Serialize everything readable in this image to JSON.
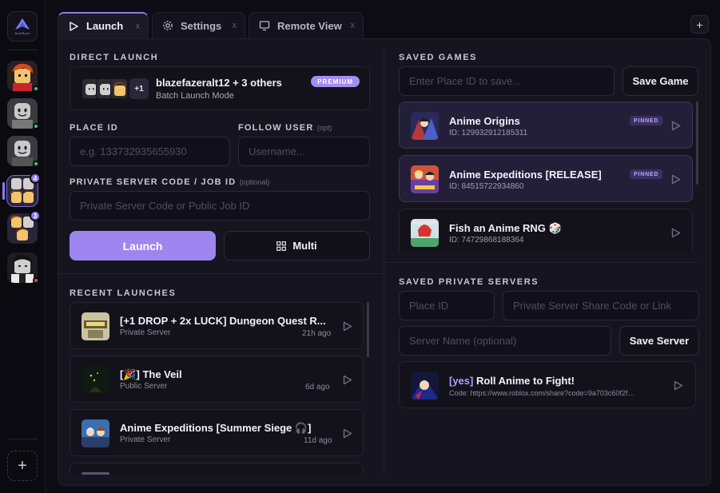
{
  "rail": {
    "logo_text": "AutoRyze",
    "accounts": [
      {
        "status": "#3ecf6a",
        "badge": ""
      },
      {
        "status": "#3ecf6a",
        "badge": ""
      },
      {
        "status": "#3ecf6a",
        "badge": ""
      },
      {
        "status": "",
        "badge": "4"
      },
      {
        "status": "",
        "badge": "3"
      },
      {
        "status": "#e8455a",
        "badge": ""
      }
    ],
    "add_label": "+"
  },
  "tabs": [
    {
      "label": "Launch",
      "close": "x"
    },
    {
      "label": "Settings",
      "close": "x"
    },
    {
      "label": "Remote View",
      "close": "x"
    }
  ],
  "new_tab_label": "+",
  "direct_launch": {
    "section_title": "DIRECT LAUNCH",
    "plus_count": "+1",
    "accounts_title": "blazefazeralt12 + 3 others",
    "mode": "Batch Launch Mode",
    "badge": "PREMIUM",
    "place_id_label": "PLACE ID",
    "place_id_placeholder": "e.g. 133732935655930",
    "follow_user_label": "FOLLOW USER",
    "follow_user_opt": "(opt)",
    "follow_user_placeholder": "Username...",
    "private_label": "PRIVATE SERVER CODE / JOB ID",
    "private_opt": "(optional)",
    "private_placeholder": "Private Server Code or Public Job ID",
    "launch_label": "Launch",
    "multi_label": "Multi"
  },
  "recent": {
    "section_title": "RECENT LAUNCHES",
    "items": [
      {
        "title": "[+1 DROP + 2x LUCK] Dungeon Quest R...",
        "type": "Private Server",
        "time": "21h ago"
      },
      {
        "title": "[🎉] The Veil",
        "type": "Public Server",
        "time": "6d ago"
      },
      {
        "title": "Anime Expeditions [Summer Siege 🎧]",
        "type": "Private Server",
        "time": "11d ago"
      }
    ]
  },
  "saved_games": {
    "section_title": "SAVED GAMES",
    "input_placeholder": "Enter Place ID to save...",
    "save_label": "Save Game",
    "items": [
      {
        "title": "Anime Origins",
        "id": "ID: 129932912185311",
        "pinned": "PINNED"
      },
      {
        "title": "Anime Expeditions [RELEASE]",
        "id": "ID: 84515722934860",
        "pinned": "PINNED"
      },
      {
        "title": "Fish an Anime RNG 🎲",
        "id": "ID: 74729868188364",
        "pinned": ""
      }
    ]
  },
  "saved_servers": {
    "section_title": "SAVED PRIVATE SERVERS",
    "place_placeholder": "Place ID",
    "code_placeholder": "Private Server Share Code or Link",
    "name_placeholder": "Server Name (optional)",
    "save_label": "Save Server",
    "items": [
      {
        "tag": "[yes]",
        "title": "Roll Anime to Fight!",
        "code": "Code: https://www.roblox.com/share?code=9a703c60f2ffa5..."
      }
    ]
  }
}
